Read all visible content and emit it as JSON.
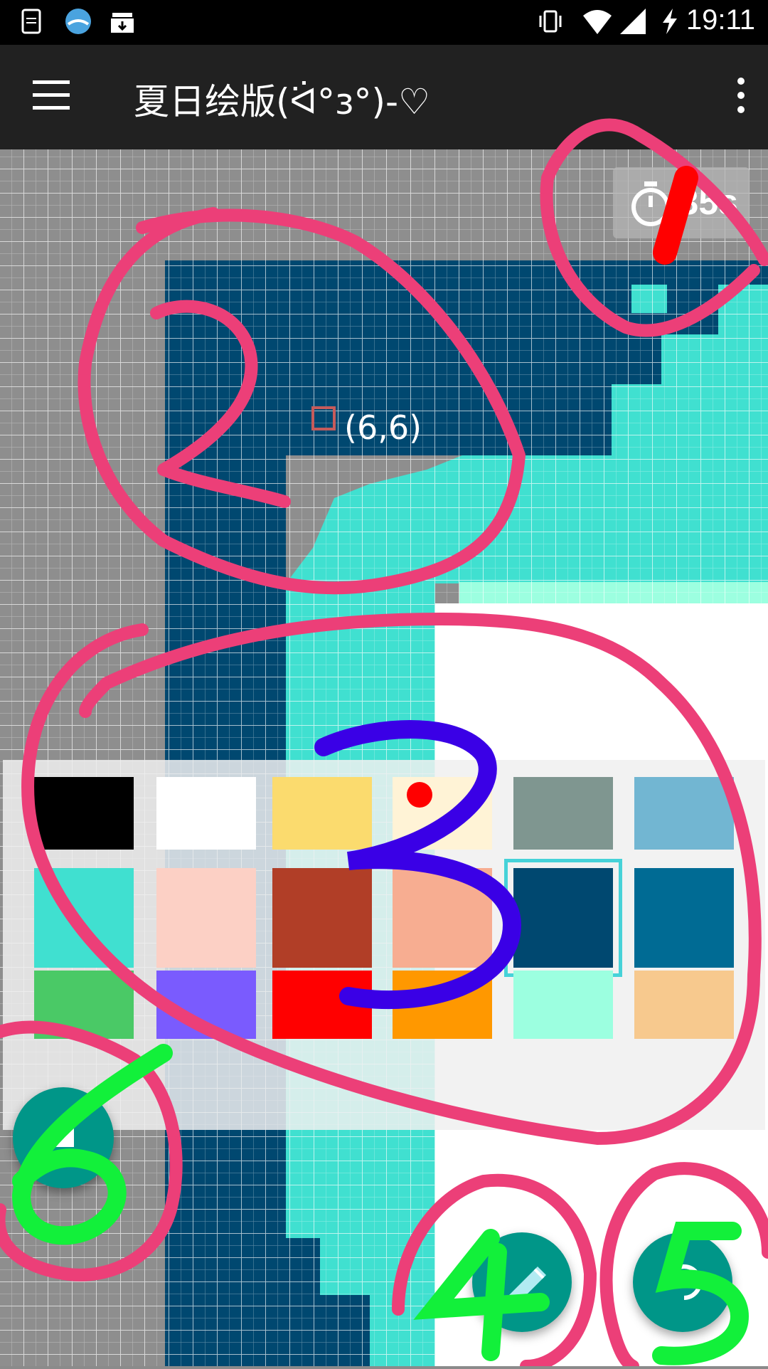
{
  "status_bar": {
    "time": "19:11",
    "left_icons": [
      "file-icon",
      "app-icon",
      "download-box-icon"
    ],
    "right_icons": [
      "vibrate-icon",
      "wifi-icon",
      "signal-icon",
      "charging-icon"
    ]
  },
  "app_bar": {
    "title": "夏日绘版(ᐛ°ɜ°)-♡"
  },
  "canvas": {
    "timer_label": "35s",
    "cursor_coord": "(6,6)"
  },
  "palette": {
    "colors": [
      "#000000",
      "#ffffff",
      "#fbdb6e",
      "#fff3d6",
      "#7f9690",
      "#72b6d2",
      "#40e0d0",
      "#fcd0c5",
      "#b13e27",
      "#f7ad91",
      "#004870",
      "#006b94",
      "#4ac966",
      "#7a5bfe",
      "#ff0000",
      "#ff9800",
      "#9cffe0",
      "#f7c98e"
    ],
    "selected_index": 10
  },
  "fabs": [
    "left-action-button",
    "pencil-button",
    "redo-button"
  ],
  "annotations": [
    "1",
    "2",
    "3",
    "4",
    "5",
    "6"
  ]
}
